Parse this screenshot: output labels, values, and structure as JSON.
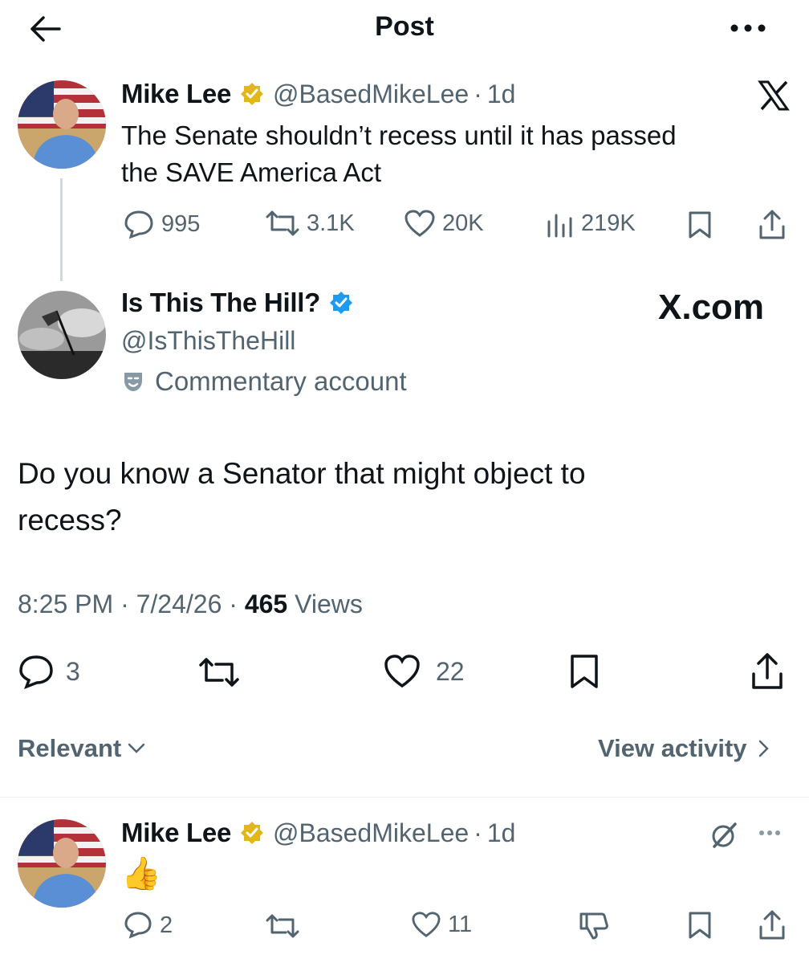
{
  "header": {
    "title": "Post"
  },
  "quoted_tweet": {
    "name": "Mike Lee",
    "handle": "@BasedMikeLee",
    "time": "1d",
    "text_line1": "The Senate shouldn’t recess until it has passed",
    "text_line2": "the SAVE America Act",
    "replies": "995",
    "reposts": "3.1K",
    "likes": "20K",
    "views": "219K"
  },
  "main_tweet": {
    "name": "Is This The Hill?",
    "handle": "@IsThisTheHill",
    "label": "Commentary account",
    "watermark": "X.com",
    "text_line1": "Do you know a Senator that might object to",
    "text_line2": "recess?",
    "time": "8:25 PM",
    "date": "7/24/26",
    "views_count": "465",
    "views_label": "Views",
    "replies": "3",
    "likes": "22"
  },
  "sort": {
    "label": "Relevant",
    "activity_label": "View activity"
  },
  "reply": {
    "name": "Mike Lee",
    "handle": "@BasedMikeLee",
    "time": "1d",
    "emoji": "👍",
    "replies": "2",
    "likes": "11"
  },
  "colors": {
    "verified_gold": "#e2b719",
    "verified_blue": "#1d9bf0",
    "text_secondary": "#536471"
  }
}
